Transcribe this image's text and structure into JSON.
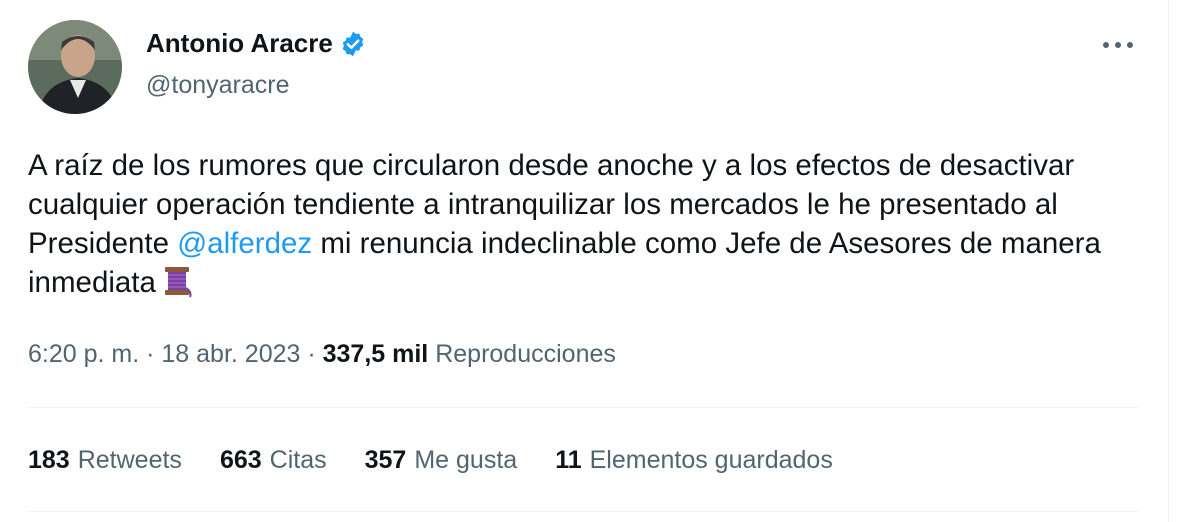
{
  "author": {
    "display_name": "Antonio Aracre",
    "handle": "@tonyaracre",
    "verified_icon": "verified-badge-icon",
    "badge_color": "#1d9bf0"
  },
  "more_icon": "more-horizontal-icon",
  "tweet": {
    "text_part1": "A raíz de los rumores que circularon desde anoche y a los efectos de desactivar cualquier operación tendiente a intranquilizar los mercados  le he presentado al Presidente ",
    "mention": "@alferdez",
    "text_part2": " mi renuncia indeclinable como Jefe de Asesores de manera inmediata",
    "emoji_icon": "thread-spool-icon",
    "mention_color": "#1d9bf0"
  },
  "meta": {
    "time": "6:20 p. m.",
    "sep1": " · ",
    "date": "18 abr. 2023",
    "sep2": " · ",
    "views_count": "337,5 mil",
    "views_label": "Reproducciones"
  },
  "stats": [
    {
      "count": "183",
      "label": "Retweets"
    },
    {
      "count": "663",
      "label": "Citas"
    },
    {
      "count": "357",
      "label": "Me gusta"
    },
    {
      "count": "11",
      "label": "Elementos guardados"
    }
  ]
}
